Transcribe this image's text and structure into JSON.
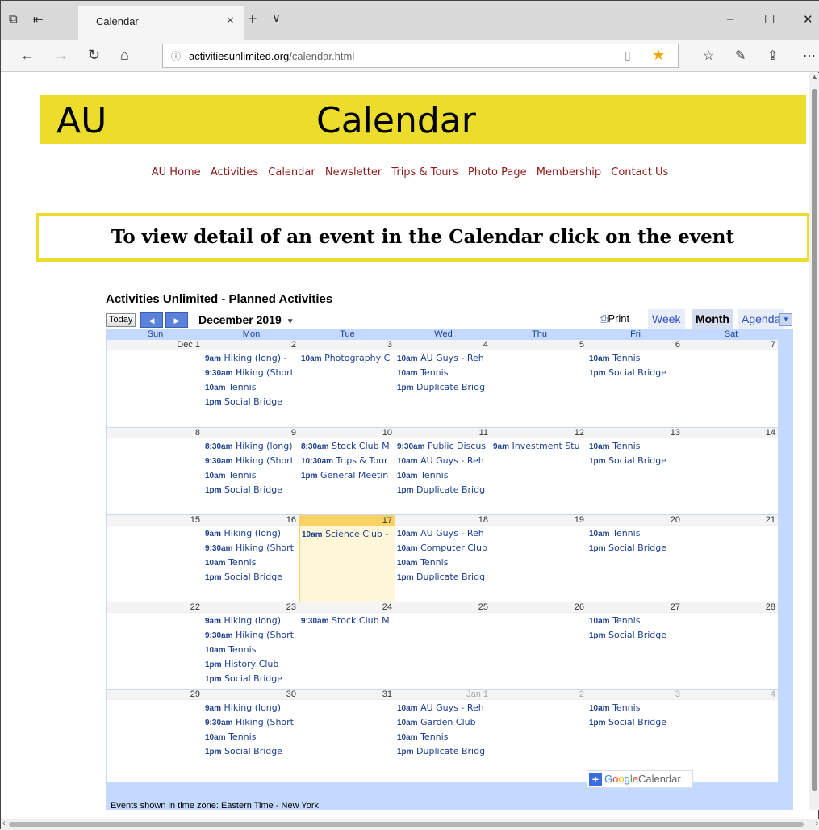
{
  "browser": {
    "tab_title": "Calendar",
    "tab_close": "×",
    "new_tab": "+",
    "tab_menu": "∨",
    "url_domain": "activitiesunlimited.org",
    "url_path": "/calendar.html",
    "win_min": "–",
    "win_max": "☐",
    "win_close": "✕"
  },
  "page": {
    "banner_left": "AU",
    "banner_center": "Calendar",
    "nav": [
      "AU Home",
      "Activities",
      "Calendar",
      "Newsletter",
      "Trips & Tours",
      "Photo Page",
      "Membership",
      "Contact Us"
    ],
    "notice": "To view detail of an event in the Calendar click on the event"
  },
  "calendar": {
    "title": "Activities Unlimited - Planned Activities",
    "today_label": "Today",
    "month_label": "December 2019",
    "print_label": "Print",
    "views": [
      "Week",
      "Month",
      "Agenda"
    ],
    "active_view": "Month",
    "weekdays": [
      "Sun",
      "Mon",
      "Tue",
      "Wed",
      "Thu",
      "Fri",
      "Sat"
    ],
    "timezone_note": "Events shown in time zone: Eastern Time - New York",
    "google_g": "Google",
    "google_cal": "Calendar",
    "weeks": [
      [
        {
          "label": "Dec 1",
          "events": []
        },
        {
          "label": "2",
          "events": [
            [
              "9am",
              "Hiking (long) -"
            ],
            [
              "9:30am",
              "Hiking (Short"
            ],
            [
              "10am",
              "Tennis"
            ],
            [
              "1pm",
              "Social Bridge"
            ]
          ]
        },
        {
          "label": "3",
          "events": [
            [
              "10am",
              "Photography C"
            ]
          ]
        },
        {
          "label": "4",
          "events": [
            [
              "10am",
              "AU Guys - Reh"
            ],
            [
              "10am",
              "Tennis"
            ],
            [
              "1pm",
              "Duplicate Bridg"
            ]
          ]
        },
        {
          "label": "5",
          "events": []
        },
        {
          "label": "6",
          "events": [
            [
              "10am",
              "Tennis"
            ],
            [
              "1pm",
              "Social Bridge"
            ]
          ]
        },
        {
          "label": "7",
          "events": []
        }
      ],
      [
        {
          "label": "8",
          "events": []
        },
        {
          "label": "9",
          "events": [
            [
              "8:30am",
              "Hiking (long)"
            ],
            [
              "9:30am",
              "Hiking (Short"
            ],
            [
              "10am",
              "Tennis"
            ],
            [
              "1pm",
              "Social Bridge"
            ]
          ]
        },
        {
          "label": "10",
          "events": [
            [
              "8:30am",
              "Stock Club M"
            ],
            [
              "10:30am",
              "Trips & Tour"
            ],
            [
              "1pm",
              "General Meetin"
            ]
          ]
        },
        {
          "label": "11",
          "events": [
            [
              "9:30am",
              "Public Discus"
            ],
            [
              "10am",
              "AU Guys - Reh"
            ],
            [
              "10am",
              "Tennis"
            ],
            [
              "1pm",
              "Duplicate Bridg"
            ]
          ]
        },
        {
          "label": "12",
          "events": [
            [
              "9am",
              "Investment Stu"
            ]
          ]
        },
        {
          "label": "13",
          "events": [
            [
              "10am",
              "Tennis"
            ],
            [
              "1pm",
              "Social Bridge"
            ]
          ]
        },
        {
          "label": "14",
          "events": []
        }
      ],
      [
        {
          "label": "15",
          "events": []
        },
        {
          "label": "16",
          "events": [
            [
              "9am",
              "Hiking (long)"
            ],
            [
              "9:30am",
              "Hiking (Short"
            ],
            [
              "10am",
              "Tennis"
            ],
            [
              "1pm",
              "Social Bridge"
            ]
          ]
        },
        {
          "label": "17",
          "today": true,
          "events": [
            [
              "10am",
              "Science Club -"
            ]
          ]
        },
        {
          "label": "18",
          "events": [
            [
              "10am",
              "AU Guys - Reh"
            ],
            [
              "10am",
              "Computer Club"
            ],
            [
              "10am",
              "Tennis"
            ],
            [
              "1pm",
              "Duplicate Bridg"
            ]
          ]
        },
        {
          "label": "19",
          "events": []
        },
        {
          "label": "20",
          "events": [
            [
              "10am",
              "Tennis"
            ],
            [
              "1pm",
              "Social Bridge"
            ]
          ]
        },
        {
          "label": "21",
          "events": []
        }
      ],
      [
        {
          "label": "22",
          "events": []
        },
        {
          "label": "23",
          "events": [
            [
              "9am",
              "Hiking (long)"
            ],
            [
              "9:30am",
              "Hiking (Short"
            ],
            [
              "10am",
              "Tennis"
            ],
            [
              "1pm",
              "History Club"
            ],
            [
              "1pm",
              "Social Bridge"
            ]
          ]
        },
        {
          "label": "24",
          "events": [
            [
              "9:30am",
              "Stock Club M"
            ]
          ]
        },
        {
          "label": "25",
          "events": []
        },
        {
          "label": "26",
          "events": []
        },
        {
          "label": "27",
          "events": [
            [
              "10am",
              "Tennis"
            ],
            [
              "1pm",
              "Social Bridge"
            ]
          ]
        },
        {
          "label": "28",
          "events": []
        }
      ],
      [
        {
          "label": "29",
          "events": []
        },
        {
          "label": "30",
          "events": [
            [
              "9am",
              "Hiking (long)"
            ],
            [
              "9:30am",
              "Hiking (Short"
            ],
            [
              "10am",
              "Tennis"
            ],
            [
              "1pm",
              "Social Bridge"
            ]
          ]
        },
        {
          "label": "31",
          "events": []
        },
        {
          "label": "Jan 1",
          "other": true,
          "events": [
            [
              "10am",
              "AU Guys - Reh"
            ],
            [
              "10am",
              "Garden Club"
            ],
            [
              "10am",
              "Tennis"
            ],
            [
              "1pm",
              "Duplicate Bridg"
            ]
          ]
        },
        {
          "label": "2",
          "other": true,
          "events": []
        },
        {
          "label": "3",
          "other": true,
          "events": [
            [
              "10am",
              "Tennis"
            ],
            [
              "1pm",
              "Social Bridge"
            ]
          ]
        },
        {
          "label": "4",
          "other": true,
          "events": []
        }
      ]
    ]
  }
}
